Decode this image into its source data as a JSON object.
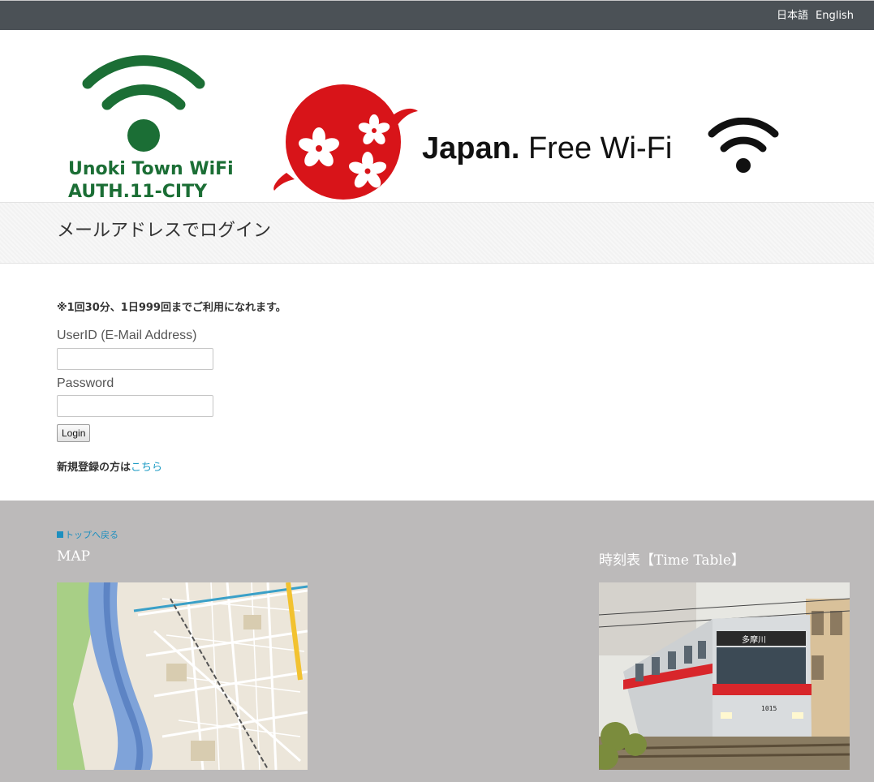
{
  "topbar": {
    "lang_ja": "日本語",
    "lang_en": "English"
  },
  "banner": {
    "unoki_line1": "Unoki Town WiFi",
    "unoki_line2": "AUTH.11-CITY",
    "japan_bold": "Japan.",
    "japan_rest": " Free Wi-Fi"
  },
  "header": {
    "title": "メールアドレスでログイン"
  },
  "form": {
    "notice": "※1回30分、1日999回までご利用になれます。",
    "userid_label": "UserID (E-Mail Address)",
    "userid_value": "",
    "password_label": "Password",
    "password_value": "",
    "login_label": "Login",
    "register_prefix": "新規登録の方は",
    "register_link": "こちら"
  },
  "footer": {
    "back_link": "トップへ戻る",
    "map_heading": "MAP",
    "timetable_heading": "時刻表【Time Table】",
    "train_dest": "多摩川",
    "train_number": "1015"
  },
  "colors": {
    "topbar": "#4b5156",
    "footer": "#bcbaba",
    "wifi_green": "#1b6e35",
    "sakura_red": "#d81419",
    "link_blue": "#1d9bc4"
  },
  "icons": {
    "banner_left": "green-wifi-icon",
    "banner_center": "sakura-sun-icon",
    "banner_right": "black-wifi-icon"
  }
}
